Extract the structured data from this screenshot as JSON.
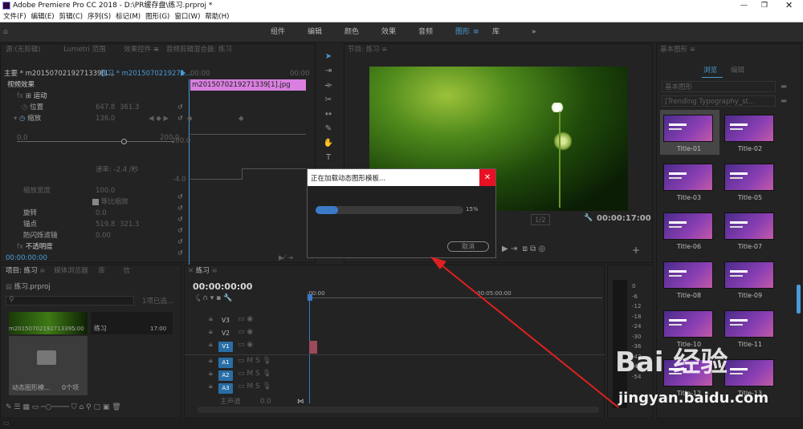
{
  "window": {
    "title": "Adobe Premiere Pro CC 2018 - D:\\PR缓存盘\\练习.prproj *"
  },
  "menu": [
    "文件(F)",
    "编辑(E)",
    "剪辑(C)",
    "序列(S)",
    "标记(M)",
    "图形(G)",
    "窗口(W)",
    "帮助(H)"
  ],
  "workspaces": [
    "组件",
    "编辑",
    "颜色",
    "效果",
    "音频",
    "图形",
    "库"
  ],
  "active_workspace": "图形",
  "source_panel": {
    "tabs": [
      "源:(无剪辑)",
      "Lumetri 范围",
      "效果控件",
      "音频剪辑混合器: 练习"
    ],
    "master": "主要 * m2015070219271339[1...",
    "seq": "练习 * m2015070219271...",
    "clip": "m2015070219271339[1].jpg",
    "time_start": "00:00",
    "time_end": "00:00",
    "video_effects": "视频效果",
    "motion": "运动",
    "position": "位置",
    "pos_x": "647.8",
    "pos_y": "361.3",
    "scale": "缩放",
    "scale_val": "136.0",
    "scale_max": "200.0",
    "range_min": "0.0",
    "range_max": "200.0",
    "speed": "速率: -2.4 /秒",
    "neg": "-4.0",
    "scale_width": "缩放宽度",
    "scale_width_val": "100.0",
    "uniform": "等比缩放",
    "rotation": "旋转",
    "rotation_val": "0.0",
    "anchor": "锚点",
    "anchor_x": "519.8",
    "anchor_y": "321.3",
    "flicker": "防闪烁滤镜",
    "flicker_val": "0.00",
    "opacity": "不透明度",
    "timecode": "00:00:00:00"
  },
  "program": {
    "title": "节目: 练习",
    "timecode": "00:00:17:00",
    "zoom": "1/2"
  },
  "dialog": {
    "title": "正在加载动态图形模板...",
    "progress": 0.15,
    "progress_label": "15%",
    "cancel": "取消"
  },
  "project": {
    "tabs": [
      "项目: 练习",
      "媒体浏览器",
      "库",
      "信"
    ],
    "name": "练习.prproj",
    "selected": "1项已选...",
    "item1_name": "m2015070219271339...",
    "item1_dur": "5:00",
    "item2_name": "练习",
    "item2_dur": "17:00",
    "folder_name": "动态图形模...",
    "folder_count": "0个项"
  },
  "timeline": {
    "title": "练习",
    "timecode": "00:00:00:00",
    "ruler_start": ":00:00",
    "ruler_mid": "00:05:00:00",
    "tracks": [
      "V3",
      "V2",
      "V1",
      "A1",
      "A2",
      "A3"
    ],
    "master": "主声道",
    "master_val": "0.0"
  },
  "meter": {
    "labels": [
      "0",
      "-6",
      "-12",
      "-18",
      "-24",
      "-30",
      "-36",
      "-42",
      "-48",
      "-54"
    ]
  },
  "essential_graphics": {
    "title": "基本图形",
    "tab_browse": "浏览",
    "tab_edit": "编辑",
    "dropdown1": "基本图形",
    "dropdown2": "[Trending Typography_st...",
    "titles": [
      "Title-01",
      "Title-02",
      "Title-03",
      "Title-05",
      "Title-06",
      "Title-07",
      "Title-08",
      "Title-09",
      "Title-10",
      "Title-11",
      "Title-12",
      "Title-13"
    ]
  },
  "watermark": {
    "brand": "Bai 经验",
    "url": "jingyan.baidu.com"
  }
}
